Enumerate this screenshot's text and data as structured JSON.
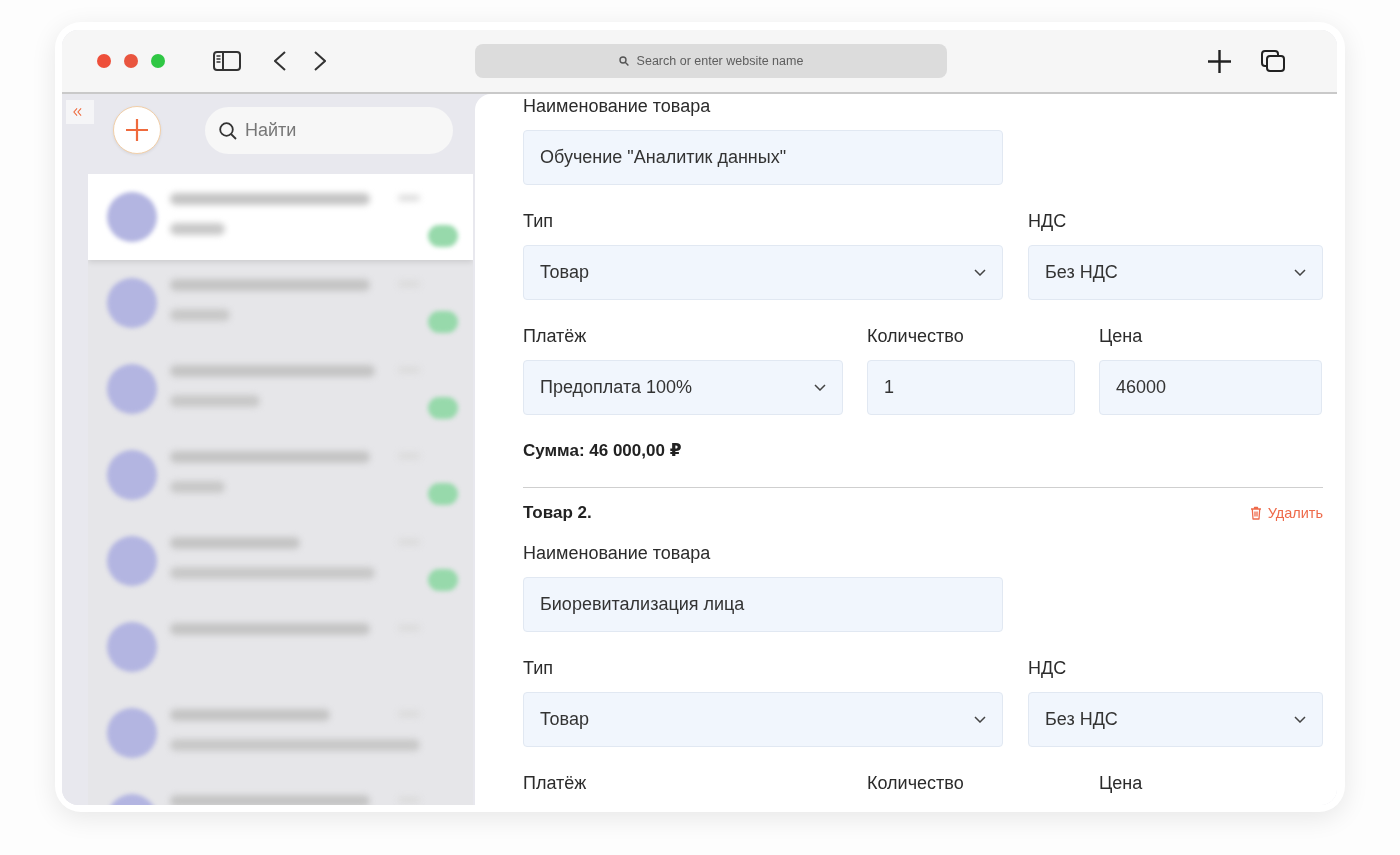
{
  "browser": {
    "address_placeholder": "Search or enter website name"
  },
  "sidebar": {
    "search": {
      "placeholder": "Найти"
    },
    "chats": [
      {
        "selected": true,
        "unread": true
      },
      {
        "selected": false,
        "unread": true
      },
      {
        "selected": false,
        "unread": true
      },
      {
        "selected": false,
        "unread": true
      },
      {
        "selected": false,
        "unread": true
      },
      {
        "selected": false,
        "unread": false
      },
      {
        "selected": false,
        "unread": false
      },
      {
        "selected": false,
        "unread": false
      }
    ]
  },
  "products": [
    {
      "rows": [
        {
          "fields": [
            {
              "label": "Наименование товара",
              "kind": "text",
              "value": "Обучение \"Аналитик данных\""
            }
          ]
        },
        {
          "fields": [
            {
              "label": "Тип",
              "kind": "select",
              "value": "Товар"
            },
            {
              "label": "НДС",
              "kind": "select",
              "value": "Без НДС"
            }
          ]
        },
        {
          "fields": [
            {
              "label": "Платёж",
              "kind": "select",
              "value": "Предоплата 100%"
            },
            {
              "label": "Количество",
              "kind": "text",
              "value": "1"
            },
            {
              "label": "Цена",
              "kind": "text",
              "value": "46000"
            }
          ]
        }
      ],
      "total": "Сумма: 46 000,00 ₽"
    },
    {
      "heading": "Товар 2.",
      "delete_label": "Удалить",
      "rows": [
        {
          "fields": [
            {
              "label": "Наименование товара",
              "kind": "text",
              "value": "Биоревитализация лица"
            }
          ]
        },
        {
          "fields": [
            {
              "label": "Тип",
              "kind": "select",
              "value": "Товар"
            },
            {
              "label": "НДС",
              "kind": "select",
              "value": "Без НДС"
            }
          ]
        },
        {
          "fields": [
            {
              "label": "Платёж"
            },
            {
              "label": "Количество"
            },
            {
              "label": "Цена"
            }
          ]
        }
      ]
    }
  ]
}
